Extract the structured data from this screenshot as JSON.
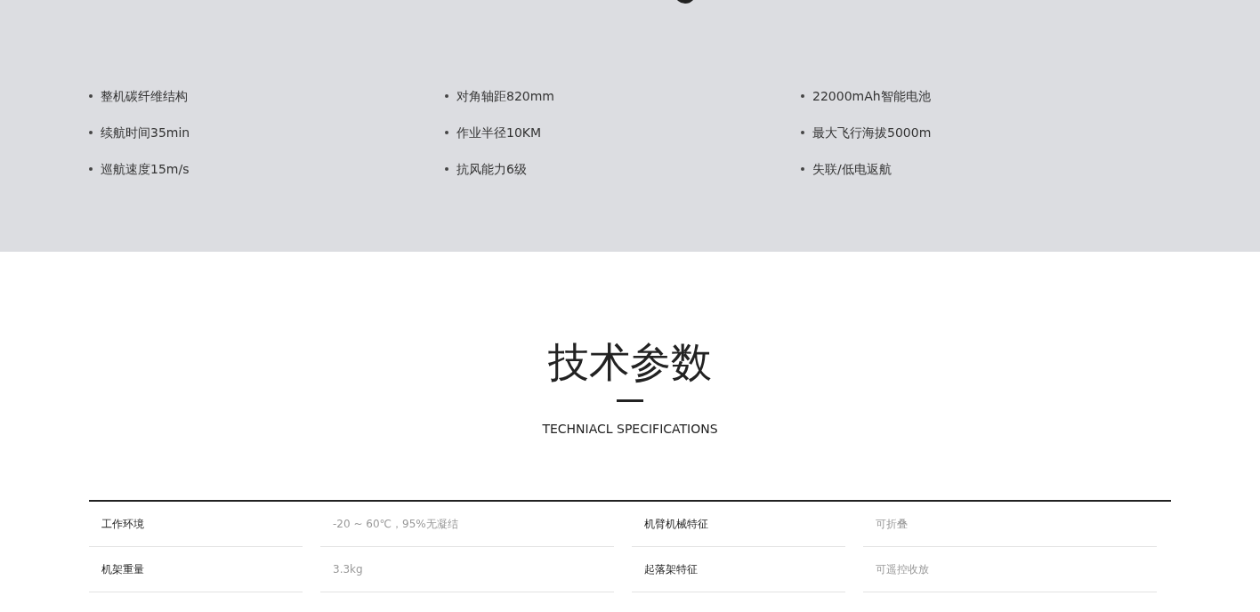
{
  "features": [
    "整机碳纤维结构",
    "对角轴距820mm",
    "22000mAh智能电池",
    "续航时间35min",
    "作业半径10KM",
    "最大飞行海拔5000m",
    "巡航速度15m/s",
    "抗风能力6级",
    "失联/低电返航"
  ],
  "section": {
    "title": "技术参数",
    "subtitle": "TECHNIACL SPECIFICATIONS"
  },
  "specs": [
    {
      "label": "工作环境",
      "value": "-20 ~ 60℃，95%无凝结"
    },
    {
      "label": "机臂机械特征",
      "value": "可折叠"
    },
    {
      "label": "机架重量",
      "value": "3.3kg"
    },
    {
      "label": "起落架特征",
      "value": "可遥控收放"
    }
  ]
}
